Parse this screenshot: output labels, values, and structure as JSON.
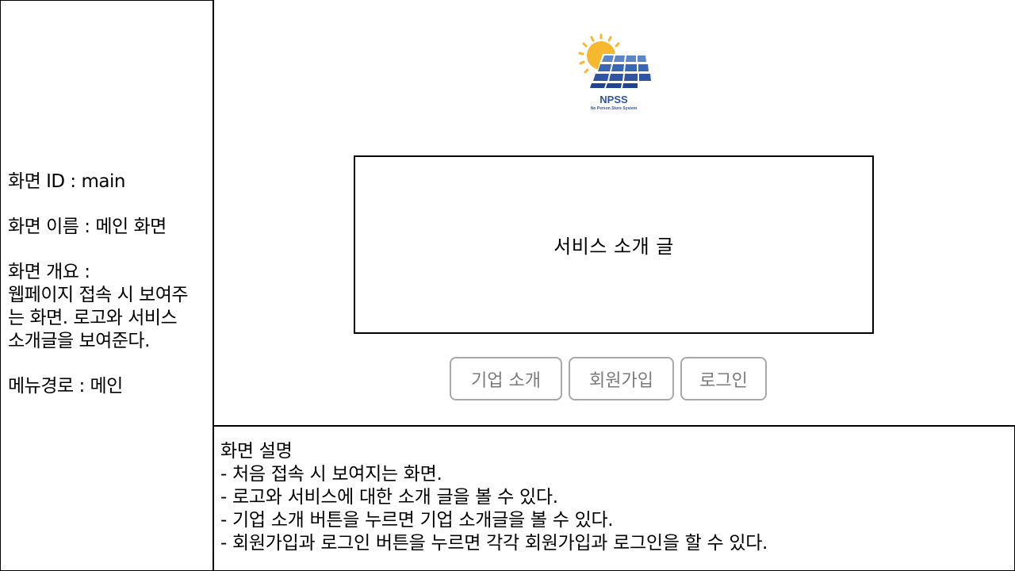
{
  "meta": {
    "screen_id": "화면 ID : main",
    "screen_name": "화면 이름 : 메인 화면",
    "overview_label": "화면 개요 :",
    "overview_lines": [
      "웹페이지 접속 시 보여주",
      "는 화면. 로고와 서비스",
      "소개글을 보여준다."
    ],
    "menu_path": "메뉴경로 : 메인"
  },
  "logo": {
    "title": "NPSS",
    "subtitle": "No Person Store System",
    "colors": {
      "sun": "#f5b82e",
      "panel": "#2e55a4",
      "panel_light": "#5b86c9"
    }
  },
  "main": {
    "intro_text": "서비스 소개 글"
  },
  "buttons": {
    "company": "기업 소개",
    "signup": "회원가입",
    "login": "로그인"
  },
  "description": {
    "title": "화면 설명",
    "lines": [
      "- 처음 접속 시 보여지는 화면.",
      "- 로고와 서비스에 대한 소개 글을 볼 수 있다.",
      "- 기업 소개 버튼을 누르면 기업 소개글을 볼 수 있다.",
      "- 회원가입과 로그인 버튼을 누르면 각각 회원가입과 로그인을 할 수 있다."
    ]
  }
}
